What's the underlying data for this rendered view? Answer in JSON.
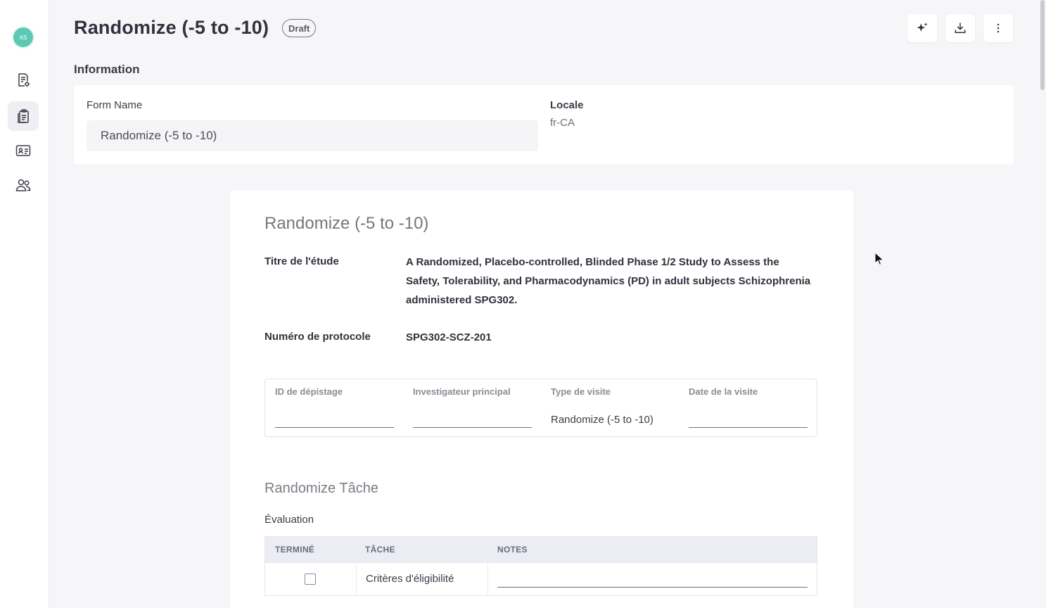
{
  "sidebar": {
    "avatar_initials": "AS",
    "items": [
      {
        "icon": "document-settings-icon"
      },
      {
        "icon": "clipboard-icon",
        "active": true
      },
      {
        "icon": "id-card-icon"
      },
      {
        "icon": "users-icon"
      }
    ]
  },
  "header": {
    "title": "Randomize (-5 to -10)",
    "status_badge": "Draft",
    "actions": [
      "sparkle-icon",
      "download-icon",
      "more-vertical-icon"
    ]
  },
  "information": {
    "section_title": "Information",
    "form_name_label": "Form Name",
    "form_name_value": "Randomize (-5 to -10)",
    "locale_label": "Locale",
    "locale_value": "fr-CA"
  },
  "preview": {
    "title": "Randomize (-5 to -10)",
    "study_title_label": "Titre de l'étude",
    "study_title_value": "A Randomized, Placebo-controlled, Blinded Phase 1/2 Study to Assess the Safety, Tolerability, and Pharmacodynamics (PD) in adult subjects Schizophrenia administered SPG302.",
    "protocol_label": "Numéro de protocole",
    "protocol_value": "SPG302-SCZ-201",
    "visit_fields": {
      "screening_id_label": "ID de dépistage",
      "investigator_label": "Investigateur principal",
      "visit_type_label": "Type de visite",
      "visit_type_value": "Randomize (-5 to -10)",
      "visit_date_label": "Date de la visite"
    },
    "task_section_title": "Randomize Tâche",
    "evaluation_label": "Évaluation",
    "table": {
      "headers": [
        "TERMINÉ",
        "TÂCHE",
        "NOTES"
      ],
      "rows": [
        {
          "task": "Critères d'éligibilité",
          "done": false
        }
      ]
    }
  },
  "colors": {
    "accent_avatar": "#5cc9b5",
    "table_header_bg": "#ececf4"
  }
}
